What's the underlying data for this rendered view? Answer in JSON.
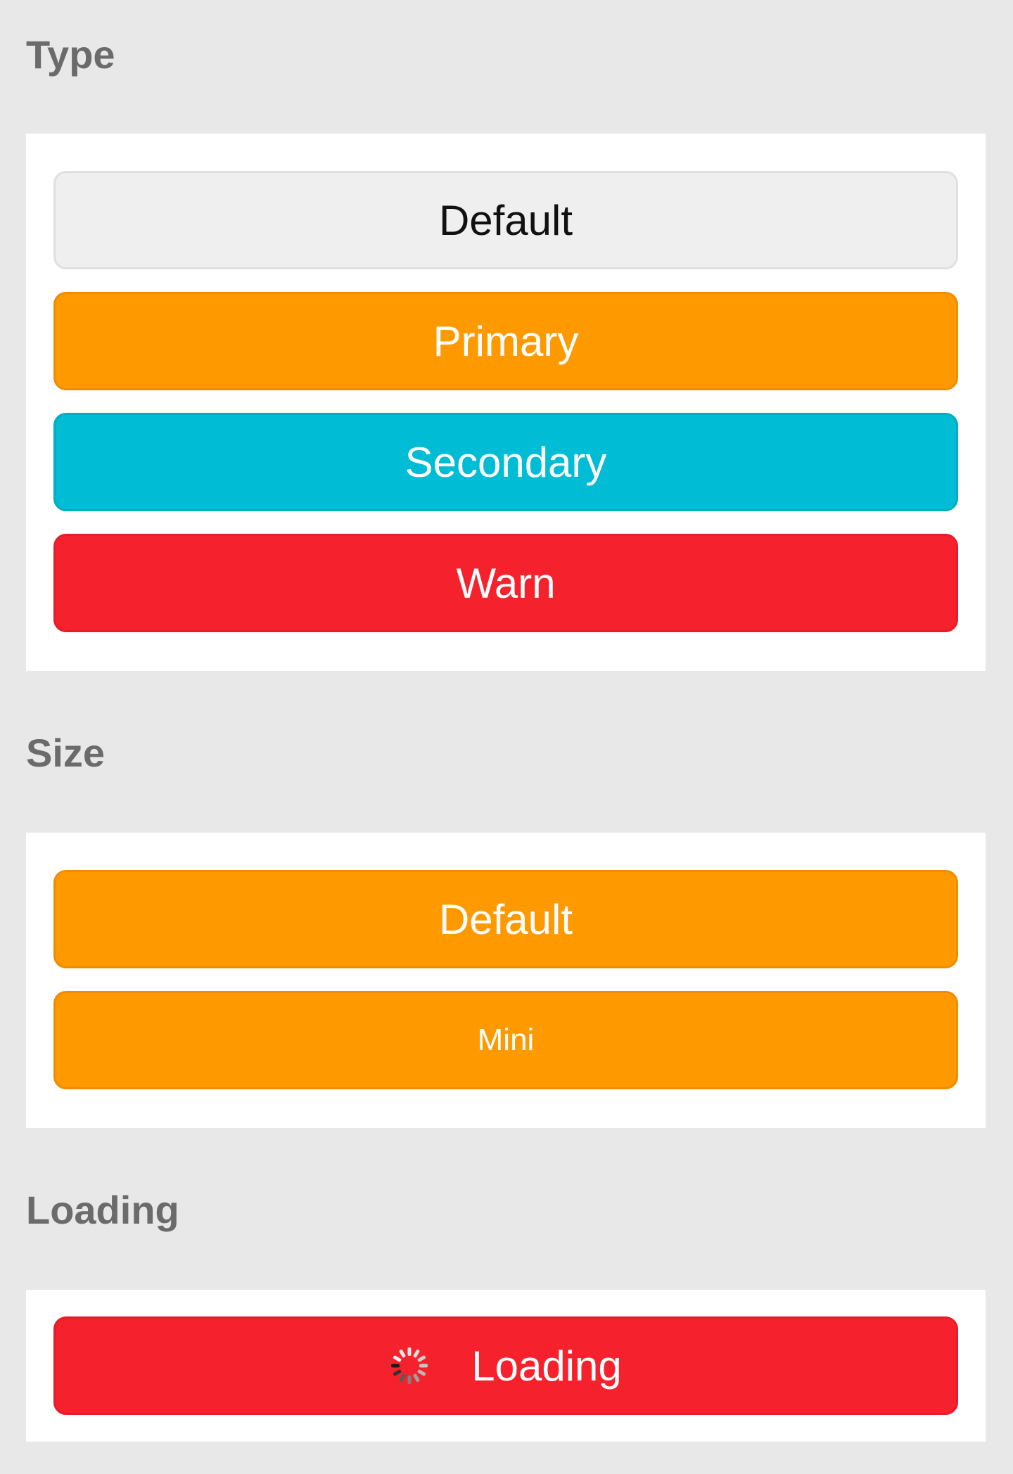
{
  "sections": [
    {
      "title": "Type",
      "buttons": [
        {
          "label": "Default",
          "type": "default"
        },
        {
          "label": "Primary",
          "type": "primary"
        },
        {
          "label": "Secondary",
          "type": "secondary"
        },
        {
          "label": "Warn",
          "type": "warn"
        }
      ]
    },
    {
      "title": "Size",
      "buttons": [
        {
          "label": "Default",
          "type": "primary",
          "size": "default"
        },
        {
          "label": "Mini",
          "type": "primary",
          "size": "mini"
        }
      ]
    },
    {
      "title": "Loading",
      "buttons": [
        {
          "label": "Loading",
          "type": "warn",
          "loading": true,
          "icon": "spinner-icon"
        }
      ]
    }
  ],
  "colors": {
    "background": "#e8e8e8",
    "panel": "#ffffff",
    "title": "#6b6b6b",
    "default": "#efefef",
    "primary": "#ff9900",
    "secondary": "#00bcd4",
    "warn": "#f5222d"
  }
}
